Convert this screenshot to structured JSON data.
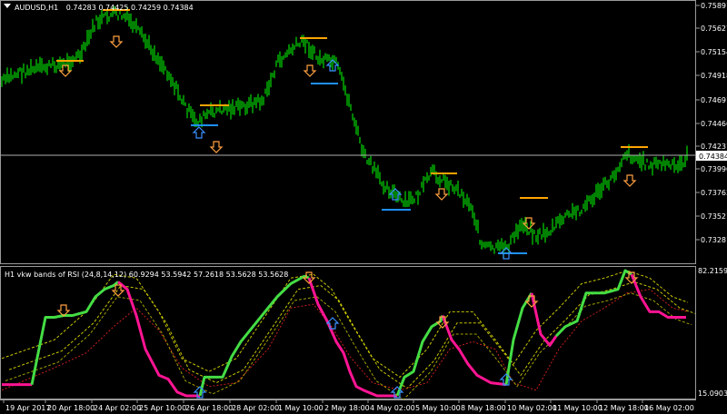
{
  "main_chart": {
    "symbol_label": "AUDUSD,H1",
    "ohlc_label": "0.74283 0.74425 0.74259 0.74384",
    "collapse_icon": "triangle-down-icon",
    "price_ticks": [
      "0.75891",
      "0.75627",
      "0.75154",
      "0.74918",
      "0.74691",
      "0.74466",
      "0.74231",
      "0.73996",
      "0.73763",
      "0.73521",
      "0.73281"
    ],
    "current_price": "0.74384",
    "colors": {
      "candles": "#00c800",
      "resistance": "#ffa500",
      "support": "#1e90ff",
      "sell_arrow": "#ffa040",
      "buy_arrow": "#3a8fff"
    }
  },
  "indicator": {
    "label": "H1 vkw bands of RSI (24,8,14,12) 60.9294 53.5942 57.2618 53.5628 53.5628",
    "top_value": "82.2159",
    "bottom_value": "15.0903",
    "colors": {
      "rising": "#44dd44",
      "falling": "#ff1493",
      "upper_band": "#c8c800",
      "lower_band": "#c81e1e"
    }
  },
  "time_axis": [
    "19 Apr 2017",
    "20 Apr 18:00",
    "24 Apr 02:00",
    "25 Apr 10:00",
    "26 Apr 18:00",
    "28 Apr 02:00",
    "1 May 10:00",
    "2 May 18:00",
    "4 May 02:00",
    "5 May 10:00",
    "8 May 18:00",
    "10 May 02:00",
    "11 May 10:00",
    "12 May 18:00",
    "16 May 02:00"
  ]
}
